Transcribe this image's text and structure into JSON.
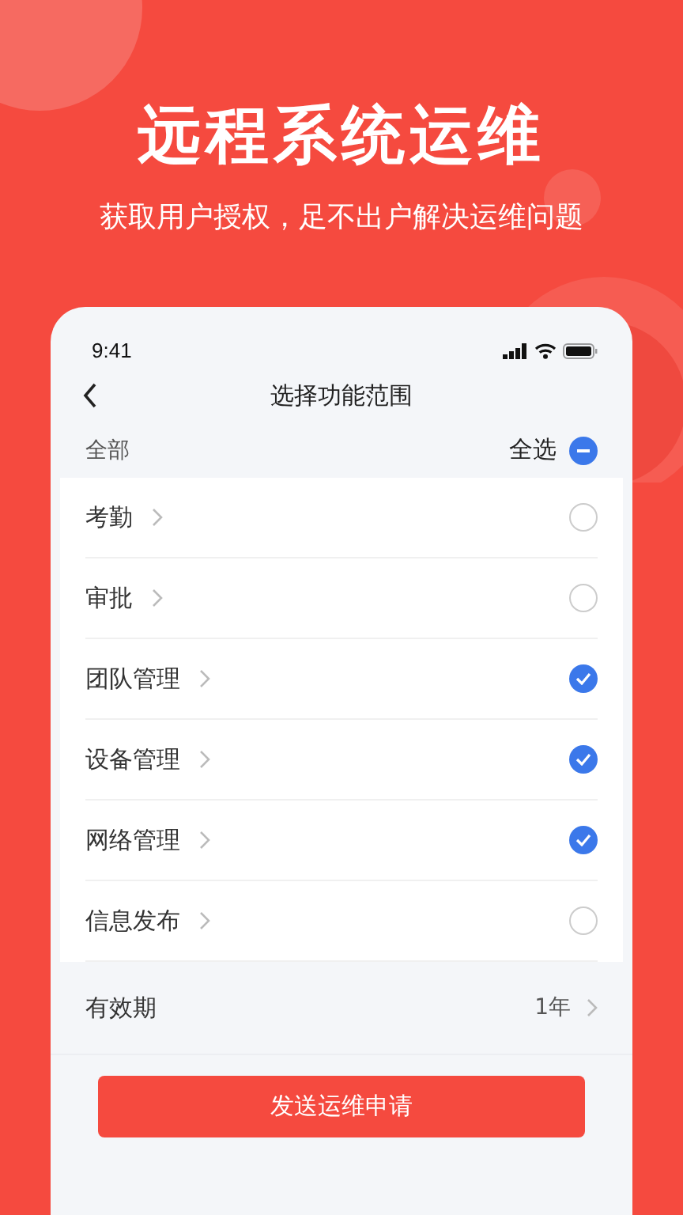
{
  "headline": "远程系统运维",
  "subtitle": "获取用户授权，足不出户解决运维问题",
  "phone": {
    "status_bar": {
      "time": "9:41"
    },
    "nav": {
      "title": "选择功能范围"
    },
    "select_all": {
      "label": "全部",
      "action": "全选",
      "partial": true
    },
    "items": [
      {
        "label": "考勤",
        "checked": false
      },
      {
        "label": "审批",
        "checked": false
      },
      {
        "label": "团队管理",
        "checked": true
      },
      {
        "label": "设备管理",
        "checked": true
      },
      {
        "label": "网络管理",
        "checked": true
      },
      {
        "label": "信息发布",
        "checked": false
      }
    ],
    "validity": {
      "label": "有效期",
      "value": "1年"
    },
    "submit_button": "发送运维申请"
  }
}
